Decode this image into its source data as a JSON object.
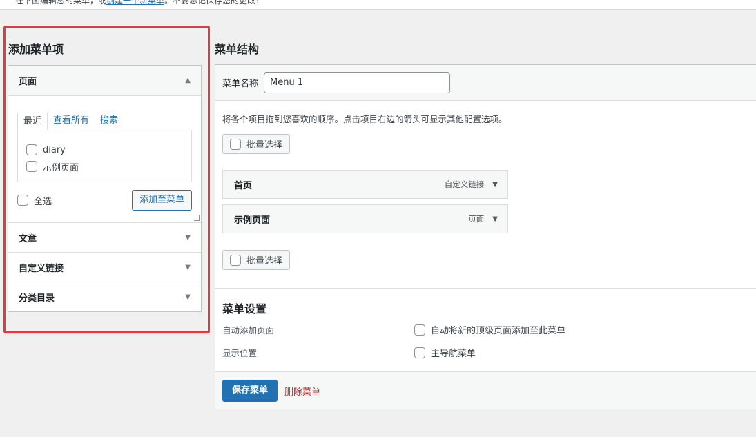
{
  "top_notice": {
    "before_link": "在下面编辑您的菜单，或",
    "link": "创建一个新菜单",
    "after_link": "。不要忘记保存您的更改！"
  },
  "add_items": {
    "title": "添加菜单项",
    "panels": [
      {
        "label": "页面",
        "expanded": true
      },
      {
        "label": "文章"
      },
      {
        "label": "自定义链接"
      },
      {
        "label": "分类目录"
      }
    ],
    "tabs": [
      "最近",
      "查看所有",
      "搜索"
    ],
    "pages": [
      "diary",
      "示例页面"
    ],
    "select_all": "全选",
    "add_button": "添加至菜单"
  },
  "structure": {
    "title": "菜单结构",
    "name_label": "菜单名称",
    "name_value": "Menu 1",
    "instructions": "将各个项目拖到您喜欢的顺序。点击项目右边的箭头可显示其他配置选项。",
    "bulk_select": "批量选择",
    "items": [
      {
        "title": "首页",
        "type": "自定义链接"
      },
      {
        "title": "示例页面",
        "type": "页面"
      }
    ]
  },
  "settings": {
    "title": "菜单设置",
    "auto_add_label": "自动添加页面",
    "auto_add_option": "自动将新的顶级页面添加至此菜单",
    "location_label": "显示位置",
    "location_option": "主导航菜单"
  },
  "footer": {
    "save": "保存菜单",
    "delete": "删除菜单"
  },
  "colors": {
    "accent": "#2271b1",
    "highlight": "#e5393b",
    "danger": "#b32d2e"
  }
}
